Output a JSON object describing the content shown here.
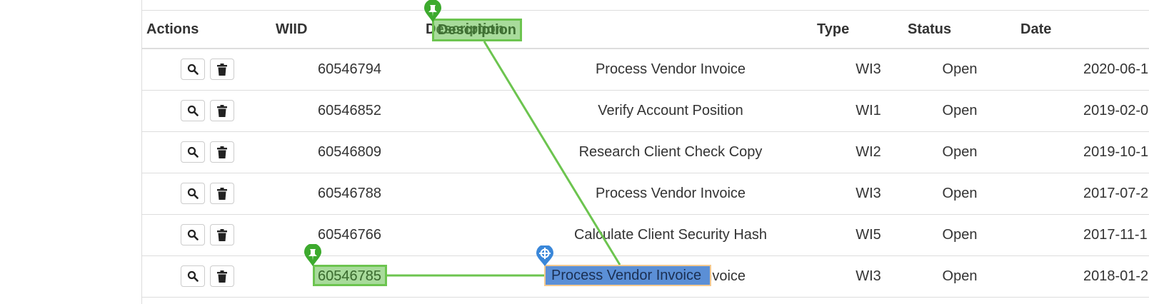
{
  "table": {
    "headers": {
      "actions": "Actions",
      "wiid": "WIID",
      "description": "Description",
      "type": "Type",
      "status": "Status",
      "date": "Date"
    },
    "rows": [
      {
        "wiid": "60546794",
        "description": "Process Vendor Invoice",
        "type": "WI3",
        "status": "Open",
        "date": "2020-06-1"
      },
      {
        "wiid": "60546852",
        "description": "Verify Account Position",
        "type": "WI1",
        "status": "Open",
        "date": "2019-02-0"
      },
      {
        "wiid": "60546809",
        "description": "Research Client Check Copy",
        "type": "WI2",
        "status": "Open",
        "date": "2019-10-1"
      },
      {
        "wiid": "60546788",
        "description": "Process Vendor Invoice",
        "type": "WI3",
        "status": "Open",
        "date": "2017-07-2"
      },
      {
        "wiid": "60546766",
        "description": "Calculate Client Security Hash",
        "type": "WI5",
        "status": "Open",
        "date": "2017-11-1"
      },
      {
        "wiid": "60546785",
        "description": "Process Vendor Invoice",
        "type": "WI3",
        "status": "Open",
        "date": "2018-01-2"
      }
    ],
    "action_icons": {
      "view": "search-icon",
      "delete": "trash-icon"
    }
  },
  "annotations": {
    "source_header_label": "Description",
    "anchor_wiid_label": "60546785",
    "target_description_label": "Process Vendor Invoice",
    "pin_icon": "pin-icon",
    "target_icon": "crosshair-target-icon",
    "colors": {
      "green_highlight": "#6cc44f",
      "blue_highlight": "#5b8fd6",
      "highlight_border": "#f4c98f",
      "pin_green": "#3daa2e",
      "pin_blue": "#3a87d9"
    }
  }
}
